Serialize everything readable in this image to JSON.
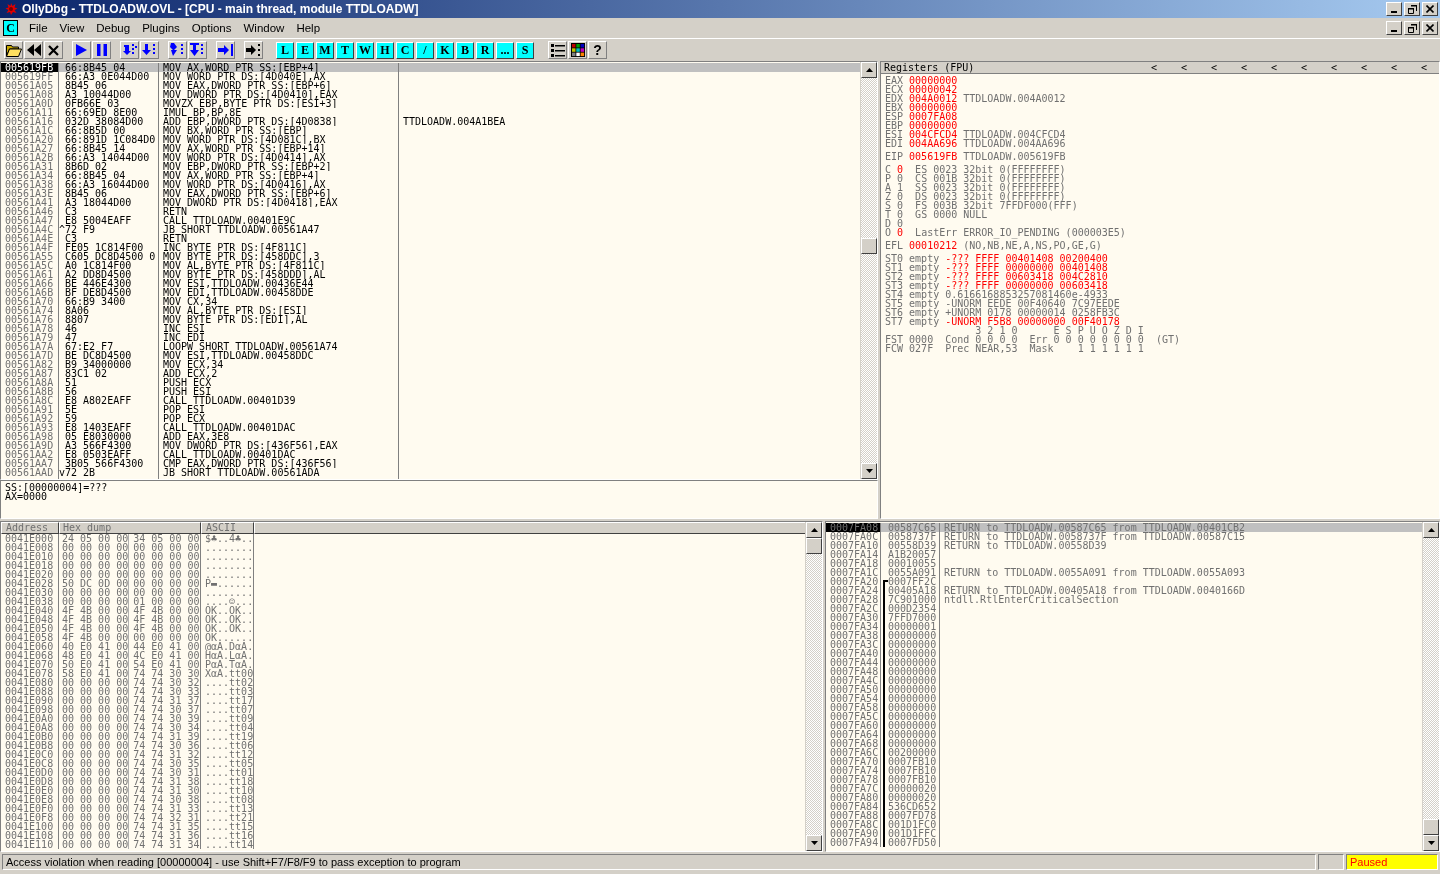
{
  "window": {
    "title": "OllyDbg - TTDLOADW.OVL - [CPU - main thread, module TTDLOADW]"
  },
  "menu": {
    "badge": "C",
    "items": [
      "File",
      "View",
      "Debug",
      "Plugins",
      "Options",
      "Window",
      "Help"
    ]
  },
  "toolbar": {
    "letters": [
      "L",
      "E",
      "M",
      "T",
      "W",
      "H",
      "C",
      "/",
      "K",
      "B",
      "R",
      "...",
      "S"
    ],
    "help": "?"
  },
  "disasm": {
    "rows": [
      {
        "address": "005619FB",
        "hex": "66:8B45 04",
        "command": "MOV AX,WORD PTR SS:[EBP+4]",
        "selected": true
      },
      {
        "address": "005619FF",
        "hex": "66:A3 0E044D00",
        "command": "MOV WORD PTR DS:[4D040E],AX",
        "selected": false
      },
      {
        "address": "00561A05",
        "hex": "8B45 06",
        "command": "MOV EAX,DWORD PTR SS:[EBP+6]",
        "selected": false
      },
      {
        "address": "00561A08",
        "hex": "A3 10044D00",
        "command": "MOV DWORD PTR DS:[4D0410],EAX",
        "selected": false
      },
      {
        "address": "00561A0D",
        "hex": "0FB66E 03",
        "command": "MOVZX EBP,BYTE PTR DS:[ESI+3]",
        "selected": false
      },
      {
        "address": "00561A11",
        "hex": "66:69ED 8E00",
        "command": "IMUL BP,BP,8E",
        "selected": false
      },
      {
        "address": "00561A16",
        "hex": "032D 38084D00",
        "command": "ADD EBP,DWORD PTR DS:[4D0838]",
        "comment": "TTDLOADW.004A1BEA",
        "selected": false
      },
      {
        "address": "00561A1C",
        "hex": "66:8B5D 00",
        "command": "MOV BX,WORD PTR SS:[EBP]",
        "selected": false
      },
      {
        "address": "00561A20",
        "hex": "66:891D 1C084D0",
        "command": "MOV WORD PTR DS:[4D081C],BX",
        "selected": false
      },
      {
        "address": "00561A27",
        "hex": "66:8B45 14",
        "command": "MOV AX,WORD PTR SS:[EBP+14]",
        "selected": false
      },
      {
        "address": "00561A2B",
        "hex": "66:A3 14044D00",
        "command": "MOV WORD PTR DS:[4D0414],AX",
        "selected": false
      },
      {
        "address": "00561A31",
        "hex": "8B6D 02",
        "command": "MOV EBP,DWORD PTR SS:[EBP+2]",
        "selected": false
      },
      {
        "address": "00561A34",
        "hex": "66:8B45 04",
        "command": "MOV AX,WORD PTR SS:[EBP+4]",
        "selected": false
      },
      {
        "address": "00561A38",
        "hex": "66:A3 16044D00",
        "command": "MOV WORD PTR DS:[4D0416],AX",
        "selected": false
      },
      {
        "address": "00561A3E",
        "hex": "8B45 06",
        "command": "MOV EAX,DWORD PTR SS:[EBP+6]",
        "selected": false
      },
      {
        "address": "00561A41",
        "hex": "A3 18044D00",
        "command": "MOV DWORD PTR DS:[4D0418],EAX",
        "selected": false
      },
      {
        "address": "00561A46",
        "hex": "C3",
        "command": "RETN",
        "selected": false
      },
      {
        "address": "00561A47",
        "hex": "E8 5004EAFF",
        "command": "CALL TTDLOADW.00401E9C",
        "selected": false
      },
      {
        "address": "00561A4C",
        "jump": "^",
        "hex": "72 F9",
        "command": "JB SHORT TTDLOADW.00561A47",
        "selected": false
      },
      {
        "address": "00561A4E",
        "hex": "C3",
        "command": "RETN",
        "selected": false
      },
      {
        "address": "00561A4F",
        "hex": "FE05 1C814F00",
        "command": "INC BYTE PTR DS:[4F811C]",
        "selected": false
      },
      {
        "address": "00561A55",
        "hex": "C605 DC8D4500 0",
        "command": "MOV BYTE PTR DS:[458DDC],3",
        "selected": false
      },
      {
        "address": "00561A5C",
        "hex": "A0 1C814F00",
        "command": "MOV AL,BYTE PTR DS:[4F811C]",
        "selected": false
      },
      {
        "address": "00561A61",
        "hex": "A2 DD8D4500",
        "command": "MOV BYTE PTR DS:[458DDD],AL",
        "selected": false
      },
      {
        "address": "00561A66",
        "hex": "BE 446E4300",
        "command": "MOV ESI,TTDLOADW.00436E44",
        "selected": false
      },
      {
        "address": "00561A6B",
        "hex": "BF DE8D4500",
        "command": "MOV EDI,TTDLOADW.00458DDE",
        "selected": false
      },
      {
        "address": "00561A70",
        "hex": "66:B9 3400",
        "command": "MOV CX,34",
        "selected": false
      },
      {
        "address": "00561A74",
        "hex": "8A06",
        "command": "MOV AL,BYTE PTR DS:[ESI]",
        "selected": false
      },
      {
        "address": "00561A76",
        "hex": "8807",
        "command": "MOV BYTE PTR DS:[EDI],AL",
        "selected": false
      },
      {
        "address": "00561A78",
        "hex": "46",
        "command": "INC ESI",
        "selected": false
      },
      {
        "address": "00561A79",
        "hex": "47",
        "command": "INC EDI",
        "selected": false
      },
      {
        "address": "00561A7A",
        "hex": "67:E2 F7",
        "command": "LOOPW SHORT TTDLOADW.00561A74",
        "selected": false
      },
      {
        "address": "00561A7D",
        "hex": "BE DC8D4500",
        "command": "MOV ESI,TTDLOADW.00458DDC",
        "selected": false
      },
      {
        "address": "00561A82",
        "hex": "B9 34000000",
        "command": "MOV ECX,34",
        "selected": false
      },
      {
        "address": "00561A87",
        "hex": "83C1 02",
        "command": "ADD ECX,2",
        "selected": false
      },
      {
        "address": "00561A8A",
        "hex": "51",
        "command": "PUSH ECX",
        "selected": false
      },
      {
        "address": "00561A8B",
        "hex": "56",
        "command": "PUSH ESI",
        "selected": false
      },
      {
        "address": "00561A8C",
        "hex": "E8 A802EAFF",
        "command": "CALL TTDLOADW.00401D39",
        "selected": false
      },
      {
        "address": "00561A91",
        "hex": "5E",
        "command": "POP ESI",
        "selected": false
      },
      {
        "address": "00561A92",
        "hex": "59",
        "command": "POP ECX",
        "selected": false
      },
      {
        "address": "00561A93",
        "hex": "E8 1403EAFF",
        "command": "CALL TTDLOADW.00401DAC",
        "selected": false
      },
      {
        "address": "00561A98",
        "hex": "05 E8030000",
        "command": "ADD EAX,3E8",
        "selected": false
      },
      {
        "address": "00561A9D",
        "hex": "A3 566F4300",
        "command": "MOV DWORD PTR DS:[436F56],EAX",
        "selected": false
      },
      {
        "address": "00561AA2",
        "hex": "E8 0503EAFF",
        "command": "CALL TTDLOADW.00401DAC",
        "selected": false
      },
      {
        "address": "00561AA7",
        "hex": "3B05 566F4300",
        "command": "CMP EAX,DWORD PTR DS:[436F56]",
        "selected": false
      },
      {
        "address": "00561AAD",
        "jump": "v",
        "hex": "72 2B",
        "command": "JB SHORT TTDLOADW.00561ADA",
        "selected": false
      }
    ],
    "info_lines": [
      "SS:[00000004]=???",
      "AX=0000"
    ]
  },
  "registers": {
    "title": "Registers (FPU)",
    "nav": [
      "<",
      "<",
      "<",
      "<",
      "<",
      "<",
      "<",
      "<",
      "<",
      "<"
    ],
    "lines": [
      {
        "kind": "reg",
        "name": "EAX",
        "value": "00000000",
        "changed": true
      },
      {
        "kind": "reg",
        "name": "ECX",
        "value": "00000042",
        "changed": true
      },
      {
        "kind": "reg",
        "name": "EDX",
        "value": "004A0012",
        "changed": true,
        "comment": "TTDLOADW.004A0012"
      },
      {
        "kind": "reg",
        "name": "EBX",
        "value": "00000000",
        "changed": true
      },
      {
        "kind": "reg",
        "name": "ESP",
        "value": "0007FA08",
        "changed": true
      },
      {
        "kind": "reg",
        "name": "EBP",
        "value": "00000000",
        "changed": true
      },
      {
        "kind": "reg",
        "name": "ESI",
        "value": "004CFCD4",
        "changed": true,
        "comment": "TTDLOADW.004CFCD4"
      },
      {
        "kind": "reg",
        "name": "EDI",
        "value": "004AA696",
        "changed": true,
        "comment": "TTDLOADW.004AA696"
      },
      {
        "kind": "gap"
      },
      {
        "kind": "reg",
        "name": "EIP",
        "value": "005619FB",
        "changed": true,
        "comment": "TTDLOADW.005619FB"
      },
      {
        "kind": "gap"
      },
      {
        "kind": "flag",
        "name": "C",
        "value": "0",
        "changed": true,
        "detail": "ES 0023 32bit 0(FFFFFFFF)"
      },
      {
        "kind": "flag",
        "name": "P",
        "value": "0",
        "changed": false,
        "detail": "CS 001B 32bit 0(FFFFFFFF)"
      },
      {
        "kind": "flag",
        "name": "A",
        "value": "1",
        "changed": false,
        "detail": "SS 0023 32bit 0(FFFFFFFF)"
      },
      {
        "kind": "flag",
        "name": "Z",
        "value": "0",
        "changed": false,
        "detail": "DS 0023 32bit 0(FFFFFFFF)"
      },
      {
        "kind": "flag",
        "name": "S",
        "value": "0",
        "changed": false,
        "detail": "FS 003B 32bit 7FFDF000(FFF)"
      },
      {
        "kind": "flag",
        "name": "T",
        "value": "0",
        "changed": false,
        "detail": "GS 0000 NULL"
      },
      {
        "kind": "flag",
        "name": "D",
        "value": "0",
        "changed": false
      },
      {
        "kind": "flag",
        "name": "O",
        "value": "0",
        "changed": true,
        "detail": "LastErr ERROR_IO_PENDING (000003E5)"
      },
      {
        "kind": "gap"
      },
      {
        "kind": "reg",
        "name": "EFL",
        "value": "00010212",
        "changed": true,
        "comment": "(NO,NB,NE,A,NS,PO,GE,G)"
      },
      {
        "kind": "gap"
      },
      {
        "kind": "fpu",
        "name": "ST0",
        "tag": "empty",
        "value": "-??? FFFF 00401408 00200400",
        "changed": true
      },
      {
        "kind": "fpu",
        "name": "ST1",
        "tag": "empty",
        "value": "-??? FFFF 00000000 00401408",
        "changed": true
      },
      {
        "kind": "fpu",
        "name": "ST2",
        "tag": "empty",
        "value": "-??? FFFF 00603418 004C2810",
        "changed": true
      },
      {
        "kind": "fpu",
        "name": "ST3",
        "tag": "empty",
        "value": "-??? FFFF 00000000 00603418",
        "changed": true
      },
      {
        "kind": "fpu",
        "name": "ST4",
        "tag": "empty",
        "value": "0.6166168853257081460e-4933",
        "changed": false
      },
      {
        "kind": "fpu",
        "name": "ST5",
        "tag": "empty",
        "value": "-UNORM EEDE 00F40640 7C97EEDE",
        "changed": false
      },
      {
        "kind": "fpu",
        "name": "ST6",
        "tag": "empty",
        "value": "+UNORM 0178 00000014 0258FB3C",
        "changed": false
      },
      {
        "kind": "fpu",
        "name": "ST7",
        "tag": "empty",
        "value": "-UNORM F5B8 00000000 00F40178",
        "changed": true
      },
      {
        "kind": "text",
        "text": "               3 2 1 0      E S P U O Z D I"
      },
      {
        "kind": "text",
        "text": "FST 0000  Cond 0 0 0 0  Err 0 0 0 0 0 0 0 0  (GT)"
      },
      {
        "kind": "text",
        "text": "FCW 027F  Prec NEAR,53  Mask    1 1 1 1 1 1"
      }
    ]
  },
  "dump": {
    "columns": [
      "Address",
      "Hex dump",
      "ASCII"
    ],
    "rows": [
      {
        "address": "0041E000",
        "hex": [
          "24 05 00 00",
          "34 05 00 00"
        ],
        "ascii": "$♣..4♣.."
      },
      {
        "address": "0041E008",
        "hex": [
          "00 00 00 00",
          "00 00 00 00"
        ],
        "ascii": "........"
      },
      {
        "address": "0041E010",
        "hex": [
          "00 00 00 00",
          "00 00 00 00"
        ],
        "ascii": "........"
      },
      {
        "address": "0041E018",
        "hex": [
          "00 00 00 00",
          "00 00 00 00"
        ],
        "ascii": "........"
      },
      {
        "address": "0041E020",
        "hex": [
          "00 00 00 00",
          "00 00 00 00"
        ],
        "ascii": "........"
      },
      {
        "address": "0041E028",
        "hex": [
          "50 DC 0D 00",
          "00 00 00 00"
        ],
        "ascii": "P▬......"
      },
      {
        "address": "0041E030",
        "hex": [
          "00 00 00 00",
          "00 00 00 00"
        ],
        "ascii": "........"
      },
      {
        "address": "0041E038",
        "hex": [
          "00 00 00 00",
          "01 00 00 00"
        ],
        "ascii": "....☺..."
      },
      {
        "address": "0041E040",
        "hex": [
          "4F 4B 00 00",
          "4F 4B 00 00"
        ],
        "ascii": "OK..OK.."
      },
      {
        "address": "0041E048",
        "hex": [
          "4F 4B 00 00",
          "4F 4B 00 00"
        ],
        "ascii": "OK..OK.."
      },
      {
        "address": "0041E050",
        "hex": [
          "4F 4B 00 00",
          "4F 4B 00 00"
        ],
        "ascii": "OK..OK.."
      },
      {
        "address": "0041E058",
        "hex": [
          "4F 4B 00 00",
          "00 00 00 00"
        ],
        "ascii": "OK......"
      },
      {
        "address": "0041E060",
        "hex": [
          "40 E0 41 00",
          "44 E0 41 00"
        ],
        "ascii": "@αA.DαA."
      },
      {
        "address": "0041E068",
        "hex": [
          "48 E0 41 00",
          "4C E0 41 00"
        ],
        "ascii": "HαA.LαA."
      },
      {
        "address": "0041E070",
        "hex": [
          "50 E0 41 00",
          "54 E0 41 00"
        ],
        "ascii": "PαA.TαA."
      },
      {
        "address": "0041E078",
        "hex": [
          "58 E0 41 00",
          "74 74 30 30"
        ],
        "ascii": "XαA.tt00"
      },
      {
        "address": "0041E080",
        "hex": [
          "00 00 00 00",
          "74 74 30 32"
        ],
        "ascii": "....tt02"
      },
      {
        "address": "0041E088",
        "hex": [
          "00 00 00 00",
          "74 74 30 33"
        ],
        "ascii": "....tt03"
      },
      {
        "address": "0041E090",
        "hex": [
          "00 00 00 00",
          "74 74 31 37"
        ],
        "ascii": "....tt17"
      },
      {
        "address": "0041E098",
        "hex": [
          "00 00 00 00",
          "74 74 30 37"
        ],
        "ascii": "....tt07"
      },
      {
        "address": "0041E0A0",
        "hex": [
          "00 00 00 00",
          "74 74 30 39"
        ],
        "ascii": "....tt09"
      },
      {
        "address": "0041E0A8",
        "hex": [
          "00 00 00 00",
          "74 74 30 34"
        ],
        "ascii": "....tt04"
      },
      {
        "address": "0041E0B0",
        "hex": [
          "00 00 00 00",
          "74 74 31 39"
        ],
        "ascii": "....tt19"
      },
      {
        "address": "0041E0B8",
        "hex": [
          "00 00 00 00",
          "74 74 30 36"
        ],
        "ascii": "....tt06"
      },
      {
        "address": "0041E0C0",
        "hex": [
          "00 00 00 00",
          "74 74 31 32"
        ],
        "ascii": "....tt12"
      },
      {
        "address": "0041E0C8",
        "hex": [
          "00 00 00 00",
          "74 74 30 35"
        ],
        "ascii": "....tt05"
      },
      {
        "address": "0041E0D0",
        "hex": [
          "00 00 00 00",
          "74 74 30 31"
        ],
        "ascii": "....tt01"
      },
      {
        "address": "0041E0D8",
        "hex": [
          "00 00 00 00",
          "74 74 31 38"
        ],
        "ascii": "....tt18"
      },
      {
        "address": "0041E0E0",
        "hex": [
          "00 00 00 00",
          "74 74 31 30"
        ],
        "ascii": "....tt10"
      },
      {
        "address": "0041E0E8",
        "hex": [
          "00 00 00 00",
          "74 74 30 38"
        ],
        "ascii": "....tt08"
      },
      {
        "address": "0041E0F0",
        "hex": [
          "00 00 00 00",
          "74 74 31 33"
        ],
        "ascii": "....tt13"
      },
      {
        "address": "0041E0F8",
        "hex": [
          "00 00 00 00",
          "74 74 32 31"
        ],
        "ascii": "....tt21"
      },
      {
        "address": "0041E100",
        "hex": [
          "00 00 00 00",
          "74 74 31 35"
        ],
        "ascii": "....tt15"
      },
      {
        "address": "0041E108",
        "hex": [
          "00 00 00 00",
          "74 74 31 36"
        ],
        "ascii": "....tt16"
      },
      {
        "address": "0041E110",
        "hex": [
          "00 00 00 00",
          "74 74 31 34"
        ],
        "ascii": "....tt14"
      }
    ]
  },
  "stack": {
    "rows": [
      {
        "address": "0007FA08",
        "value": "00587C65",
        "comment": "RETURN to TTDLOADW.00587C65 from TTDLOADW.00401CB2",
        "selected": true,
        "bracket": false
      },
      {
        "address": "0007FA0C",
        "value": "0058737F",
        "comment": "RETURN to TTDLOADW.0058737F from TTDLOADW.00587C15",
        "selected": false,
        "bracket": false
      },
      {
        "address": "0007FA10",
        "value": "00558D39",
        "comment": "RETURN to TTDLOADW.00558D39",
        "selected": false,
        "bracket": false
      },
      {
        "address": "0007FA14",
        "value": "A1B20057",
        "selected": false,
        "bracket": false
      },
      {
        "address": "0007FA18",
        "value": "00010055",
        "selected": false,
        "bracket": false
      },
      {
        "address": "0007FA1C",
        "value": "0055A091",
        "comment": "RETURN to TTDLOADW.0055A091 from TTDLOADW.0055A093",
        "selected": false,
        "bracket": false
      },
      {
        "address": "0007FA20",
        "value": "0007FF2C",
        "selected": false,
        "bracket": true
      },
      {
        "address": "0007FA24",
        "value": "00405A18",
        "comment": "RETURN to TTDLOADW.00405A18 from TTDLOADW.0040166D",
        "selected": false,
        "bracket": true
      },
      {
        "address": "0007FA28",
        "value": "7C901000",
        "comment": "ntdll.RtlEnterCriticalSection",
        "selected": false,
        "bracket": true
      },
      {
        "address": "0007FA2C",
        "value": "000D2354",
        "selected": false,
        "bracket": true
      },
      {
        "address": "0007FA30",
        "value": "7FFD7000",
        "selected": false,
        "bracket": true
      },
      {
        "address": "0007FA34",
        "value": "00000001",
        "selected": false,
        "bracket": true
      },
      {
        "address": "0007FA38",
        "value": "00000000",
        "selected": false,
        "bracket": true
      },
      {
        "address": "0007FA3C",
        "value": "00000000",
        "selected": false,
        "bracket": true
      },
      {
        "address": "0007FA40",
        "value": "00000000",
        "selected": false,
        "bracket": true
      },
      {
        "address": "0007FA44",
        "value": "00000000",
        "selected": false,
        "bracket": true
      },
      {
        "address": "0007FA48",
        "value": "00000000",
        "selected": false,
        "bracket": true
      },
      {
        "address": "0007FA4C",
        "value": "00000000",
        "selected": false,
        "bracket": true
      },
      {
        "address": "0007FA50",
        "value": "00000000",
        "selected": false,
        "bracket": true
      },
      {
        "address": "0007FA54",
        "value": "00000000",
        "selected": false,
        "bracket": true
      },
      {
        "address": "0007FA58",
        "value": "00000000",
        "selected": false,
        "bracket": true
      },
      {
        "address": "0007FA5C",
        "value": "00000000",
        "selected": false,
        "bracket": true
      },
      {
        "address": "0007FA60",
        "value": "00000000",
        "selected": false,
        "bracket": true
      },
      {
        "address": "0007FA64",
        "value": "00000000",
        "selected": false,
        "bracket": true
      },
      {
        "address": "0007FA68",
        "value": "00000000",
        "selected": false,
        "bracket": true
      },
      {
        "address": "0007FA6C",
        "value": "00200000",
        "selected": false,
        "bracket": true
      },
      {
        "address": "0007FA70",
        "value": "0007FB10",
        "selected": false,
        "bracket": true
      },
      {
        "address": "0007FA74",
        "value": "0007FB10",
        "selected": false,
        "bracket": true
      },
      {
        "address": "0007FA78",
        "value": "0007FB10",
        "selected": false,
        "bracket": true
      },
      {
        "address": "0007FA7C",
        "value": "00000020",
        "selected": false,
        "bracket": true
      },
      {
        "address": "0007FA80",
        "value": "00000020",
        "selected": false,
        "bracket": true
      },
      {
        "address": "0007FA84",
        "value": "536CD652",
        "selected": false,
        "bracket": true
      },
      {
        "address": "0007FA88",
        "value": "0007FD78",
        "selected": false,
        "bracket": true
      },
      {
        "address": "0007FA8C",
        "value": "001D1FC0",
        "selected": false,
        "bracket": true
      },
      {
        "address": "0007FA90",
        "value": "001D1FFC",
        "selected": false,
        "bracket": true
      },
      {
        "address": "0007FA94",
        "value": "0007FD50",
        "selected": false,
        "bracket": true
      }
    ]
  },
  "status_bar": {
    "message": "Access violation when reading [00000004] - use Shift+F7/F8/F9 to pass exception to program",
    "state": "Paused"
  }
}
